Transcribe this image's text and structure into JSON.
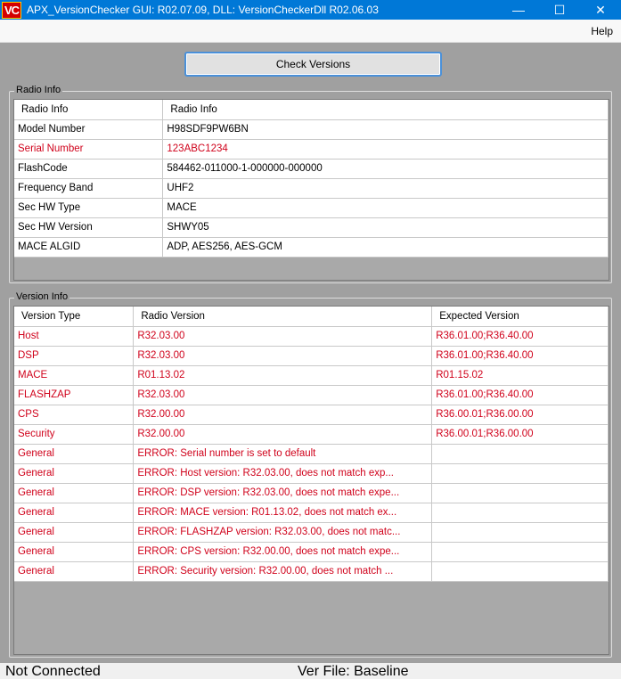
{
  "window": {
    "title": "APX_VersionChecker GUI: R02.07.09, DLL: VersionCheckerDll R02.06.03",
    "icon_text": "VC",
    "controls": [
      "—",
      "☐",
      "✕"
    ]
  },
  "menu": {
    "help": "Help"
  },
  "toolbar": {
    "check_versions": "Check Versions"
  },
  "radio_info": {
    "title": "Radio Info",
    "headers": [
      "Radio Info",
      "Radio Info"
    ],
    "rows": [
      {
        "label": "Model Number",
        "value": "H98SDF9PW6BN",
        "error": false
      },
      {
        "label": "Serial Number",
        "value": "123ABC1234",
        "error": true
      },
      {
        "label": "FlashCode",
        "value": "584462-011000-1-000000-000000",
        "error": false
      },
      {
        "label": "Frequency Band",
        "value": "UHF2",
        "error": false
      },
      {
        "label": "Sec HW Type",
        "value": "MACE",
        "error": false
      },
      {
        "label": "Sec HW Version",
        "value": "SHWY05",
        "error": false
      },
      {
        "label": "MACE ALGID",
        "value": "ADP, AES256, AES-GCM",
        "error": false
      }
    ]
  },
  "version_info": {
    "title": "Version Info",
    "headers": [
      "Version Type",
      "Radio Version",
      "Expected Version"
    ],
    "rows": [
      {
        "type": "Host",
        "radio": "R32.03.00",
        "expected": "R36.01.00;R36.40.00"
      },
      {
        "type": "DSP",
        "radio": "R32.03.00",
        "expected": "R36.01.00;R36.40.00"
      },
      {
        "type": "MACE",
        "radio": "R01.13.02",
        "expected": "R01.15.02"
      },
      {
        "type": "FLASHZAP",
        "radio": "R32.03.00",
        "expected": "R36.01.00;R36.40.00"
      },
      {
        "type": "CPS",
        "radio": "R32.00.00",
        "expected": "R36.00.01;R36.00.00"
      },
      {
        "type": "Security",
        "radio": "R32.00.00",
        "expected": "R36.00.01;R36.00.00"
      },
      {
        "type": "General",
        "radio": "ERROR: Serial number is set to default",
        "expected": ""
      },
      {
        "type": "General",
        "radio": "ERROR: Host version: R32.03.00, does not match exp...",
        "expected": ""
      },
      {
        "type": "General",
        "radio": "ERROR: DSP version: R32.03.00, does not match expe...",
        "expected": ""
      },
      {
        "type": "General",
        "radio": "ERROR: MACE version: R01.13.02, does not match ex...",
        "expected": ""
      },
      {
        "type": "General",
        "radio": "ERROR: FLASHZAP version: R32.03.00, does not matc...",
        "expected": ""
      },
      {
        "type": "General",
        "radio": "ERROR: CPS version: R32.00.00, does not match expe...",
        "expected": ""
      },
      {
        "type": "General",
        "radio": "ERROR: Security version: R32.00.00, does not match ...",
        "expected": ""
      }
    ]
  },
  "status": {
    "connection": "Not Connected",
    "ver_file": "Ver File: Baseline"
  },
  "colors": {
    "titlebar": "#0078d7",
    "error_text": "#d0021b",
    "background": "#a0a0a0"
  }
}
